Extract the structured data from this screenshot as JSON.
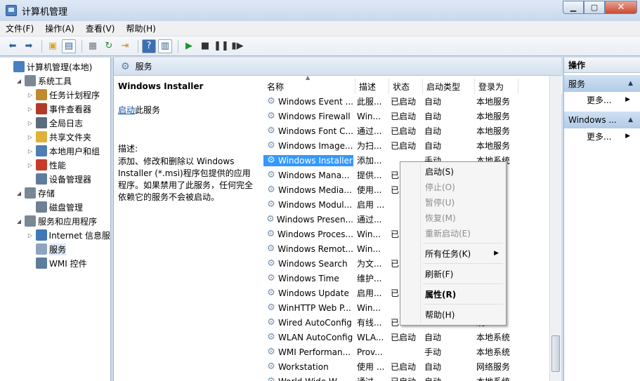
{
  "window": {
    "title": "计算机管理"
  },
  "menu": [
    "文件(F)",
    "操作(A)",
    "查看(V)",
    "帮助(H)"
  ],
  "tree": [
    {
      "label": "计算机管理(本地)",
      "indent": 0,
      "tri": "",
      "icon": "computer-management-icon",
      "color": "#4a7fc0"
    },
    {
      "label": "系统工具",
      "indent": 1,
      "tri": "◢",
      "icon": "system-tools-icon",
      "color": "#7a8896"
    },
    {
      "label": "任务计划程序",
      "indent": 2,
      "tri": "▷",
      "icon": "task-scheduler-icon",
      "color": "#c08a2e"
    },
    {
      "label": "事件查看器",
      "indent": 2,
      "tri": "▷",
      "icon": "event-viewer-icon",
      "color": "#b33a2a"
    },
    {
      "label": "全局日志",
      "indent": 2,
      "tri": "▷",
      "icon": "global-log-icon",
      "color": "#5b6c7e"
    },
    {
      "label": "共享文件夹",
      "indent": 2,
      "tri": "▷",
      "icon": "shared-folder-icon",
      "color": "#e0b13a"
    },
    {
      "label": "本地用户和组",
      "indent": 2,
      "tri": "▷",
      "icon": "users-icon",
      "color": "#4f7db5"
    },
    {
      "label": "性能",
      "indent": 2,
      "tri": "▷",
      "icon": "performance-icon",
      "color": "#c83a2a"
    },
    {
      "label": "设备管理器",
      "indent": 2,
      "tri": "",
      "icon": "device-manager-icon",
      "color": "#5e7d9a"
    },
    {
      "label": "存储",
      "indent": 1,
      "tri": "◢",
      "icon": "storage-icon",
      "color": "#7a8896"
    },
    {
      "label": "磁盘管理",
      "indent": 2,
      "tri": "",
      "icon": "disk-icon",
      "color": "#6e8095"
    },
    {
      "label": "服务和应用程序",
      "indent": 1,
      "tri": "◢",
      "icon": "services-apps-icon",
      "color": "#7a8896"
    },
    {
      "label": "Internet 信息服",
      "indent": 2,
      "tri": "▷",
      "icon": "iis-icon",
      "color": "#3f78b8"
    },
    {
      "label": "服务",
      "indent": 2,
      "tri": "",
      "icon": "services-icon",
      "color": "#8fa5bf",
      "selected": true
    },
    {
      "label": "WMI 控件",
      "indent": 2,
      "tri": "",
      "icon": "wmi-icon",
      "color": "#5e7d9a"
    }
  ],
  "mid": {
    "header": "服务",
    "desc_title": "Windows Installer",
    "start_link": "启动",
    "start_suffix": "此服务",
    "desc_label": "描述:",
    "desc_text": "添加、修改和删除以 Windows Installer (*.msi)程序包提供的应用程序。如果禁用了此服务，任何完全依赖它的服务不会被启动。"
  },
  "columns": [
    "名称",
    "描述",
    "状态",
    "启动类型",
    "登录为"
  ],
  "rows": [
    [
      "Windows Event ...",
      "此服...",
      "已启动",
      "自动",
      "本地服务"
    ],
    [
      "Windows Firewall",
      "Win...",
      "已启动",
      "自动",
      "本地服务"
    ],
    [
      "Windows Font C...",
      "通过...",
      "已启动",
      "自动",
      "本地服务"
    ],
    [
      "Windows Image...",
      "为扫...",
      "已启动",
      "自动",
      "本地服务"
    ],
    [
      "Windows Installer",
      "添加...",
      "",
      "手动",
      "本地系统"
    ],
    [
      "Windows Mana...",
      "提供...",
      "已",
      "",
      "统"
    ],
    [
      "Windows Media...",
      "使用...",
      "已",
      "",
      "务"
    ],
    [
      "Windows Modul...",
      "启用 ...",
      "",
      "",
      "统"
    ],
    [
      "Windows Presen...",
      "通过...",
      "",
      "",
      "务"
    ],
    [
      "Windows Proces...",
      "Win...",
      "已",
      "",
      "统"
    ],
    [
      "Windows Remot...",
      "Win...",
      "",
      "",
      "务"
    ],
    [
      "Windows Search",
      "为文...",
      "已",
      "",
      "统"
    ],
    [
      "Windows Time",
      "维护...",
      "",
      "",
      "务"
    ],
    [
      "Windows Update",
      "启用...",
      "已",
      "",
      "统"
    ],
    [
      "WinHTTP Web P...",
      "Win...",
      "",
      "",
      "务"
    ],
    [
      "Wired AutoConfig",
      "有线...",
      "已",
      "",
      "统"
    ],
    [
      "WLAN AutoConfig",
      "WLA...",
      "已启动",
      "自动",
      "本地系统"
    ],
    [
      "WMI Performan...",
      "Prov...",
      "",
      "手动",
      "本地系统"
    ],
    [
      "Workstation",
      "使用 ...",
      "已启动",
      "自动",
      "网络服务"
    ],
    [
      "World Wide W...",
      "通过...",
      "已启动",
      "自动",
      "本地系统"
    ]
  ],
  "context_menu": [
    {
      "label": "启动(S)",
      "state": "enabled"
    },
    {
      "label": "停止(O)",
      "state": "disabled"
    },
    {
      "label": "暂停(U)",
      "state": "disabled"
    },
    {
      "label": "恢复(M)",
      "state": "disabled"
    },
    {
      "label": "重新启动(E)",
      "state": "disabled"
    },
    {
      "sep": true
    },
    {
      "label": "所有任务(K)",
      "state": "enabled",
      "submenu": true
    },
    {
      "sep": true
    },
    {
      "label": "刷新(F)",
      "state": "enabled"
    },
    {
      "sep": true
    },
    {
      "label": "属性(R)",
      "state": "bold"
    },
    {
      "sep": true
    },
    {
      "label": "帮助(H)",
      "state": "enabled"
    }
  ],
  "actions": {
    "title": "操作",
    "groups": [
      {
        "label": "服务",
        "more": "更多..."
      },
      {
        "label": "Windows ...",
        "more": "更多..."
      }
    ]
  }
}
